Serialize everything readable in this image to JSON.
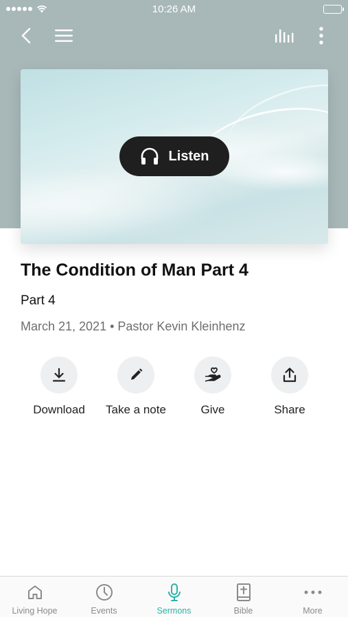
{
  "status_bar": {
    "time": "10:26 AM"
  },
  "sermon": {
    "listen_label": "Listen",
    "title": "The Condition of Man Part 4",
    "subtitle": "Part 4",
    "meta": "March 21, 2021 • Pastor Kevin Kleinhenz"
  },
  "actions": [
    {
      "label": "Download",
      "icon": "download-icon"
    },
    {
      "label": "Take a note",
      "icon": "pencil-icon"
    },
    {
      "label": "Give",
      "icon": "give-hand-heart-icon"
    },
    {
      "label": "Share",
      "icon": "share-icon"
    }
  ],
  "tabbar": {
    "active_color": "#2bb3a6",
    "items": [
      {
        "label": "Living Hope",
        "icon": "home-icon"
      },
      {
        "label": "Events",
        "icon": "clock-icon"
      },
      {
        "label": "Sermons",
        "icon": "microphone-icon",
        "active": true
      },
      {
        "label": "Bible",
        "icon": "bible-icon"
      },
      {
        "label": "More",
        "icon": "more-dots-icon"
      }
    ]
  },
  "colors": {
    "header_bg": "#a8b8b9",
    "listen_button_bg": "#1f1f1f"
  }
}
